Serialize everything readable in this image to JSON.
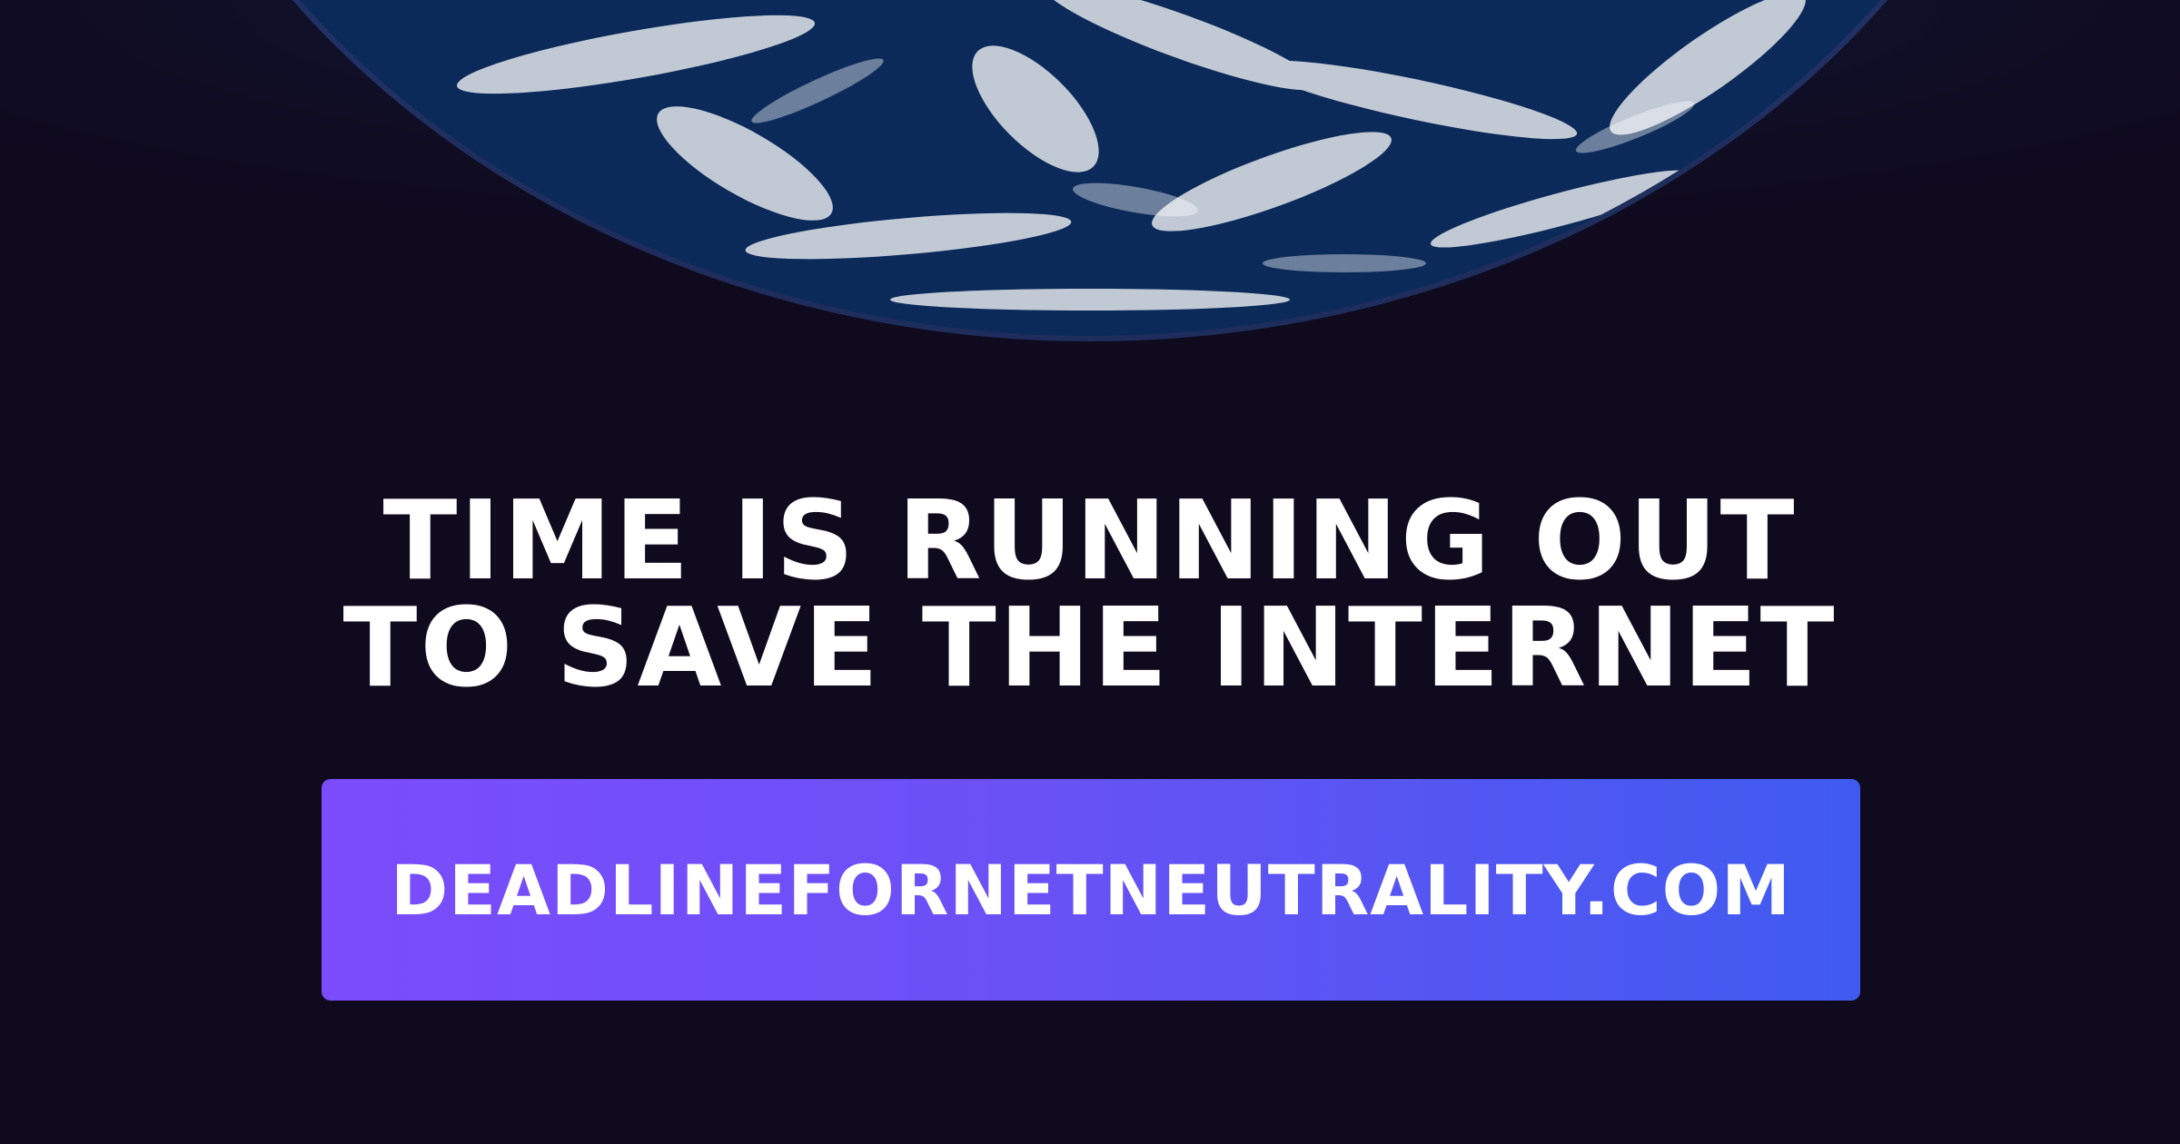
{
  "headline": {
    "line1": "TIME IS RUNNING OUT",
    "line2": "TO SAVE THE INTERNET"
  },
  "cta": {
    "label": "DEADLINEFORNETNEUTRALITY.COM"
  },
  "colors": {
    "background": "#0f0a1e",
    "text": "#ffffff",
    "cta_gradient_start": "#7b4cfb",
    "cta_gradient_end": "#3f5bef",
    "earth_ocean": "#2a8fd6"
  },
  "images": {
    "hero": "earth-from-space"
  }
}
